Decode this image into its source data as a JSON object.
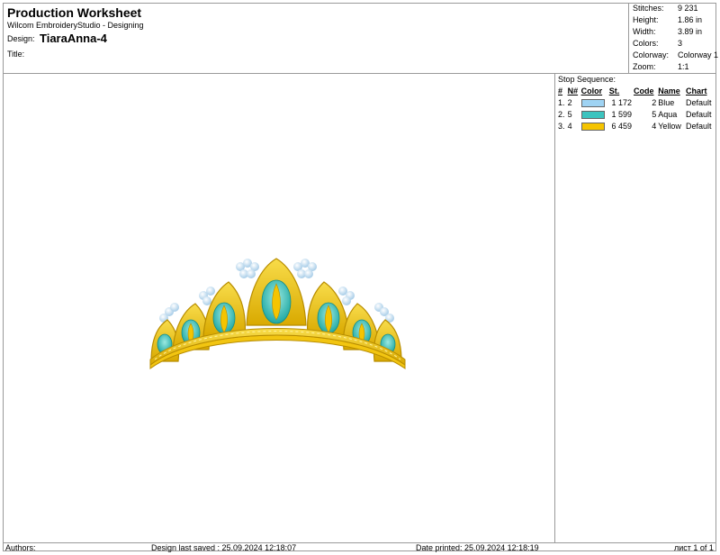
{
  "header": {
    "title": "Production Worksheet",
    "app": "Wilcom EmbroideryStudio - Designing",
    "design_label": "Design:",
    "design_value": "TiaraAnna-4",
    "title_label": "Title:"
  },
  "stats": [
    {
      "label": "Stitches:",
      "value": "9 231"
    },
    {
      "label": "Height:",
      "value": "1.86 in"
    },
    {
      "label": "Width:",
      "value": "3.89 in"
    },
    {
      "label": "Colors:",
      "value": "3"
    },
    {
      "label": "Colorway:",
      "value": "Colorway 1"
    },
    {
      "label": "Zoom:",
      "value": "1:1"
    }
  ],
  "stop_sequence": {
    "title": "Stop Sequence:",
    "headers": [
      "#",
      "N#",
      "Color",
      "St.",
      "Code",
      "Name",
      "Chart"
    ],
    "rows": [
      {
        "idx": "1.",
        "n": "2",
        "color": "#9fd3f3",
        "st": "1 172",
        "code": "2",
        "name": "Blue",
        "chart": "Default"
      },
      {
        "idx": "2.",
        "n": "5",
        "color": "#3cc4bf",
        "st": "1 599",
        "code": "5",
        "name": "Aqua",
        "chart": "Default"
      },
      {
        "idx": "3.",
        "n": "4",
        "color": "#f5c400",
        "st": "6 459",
        "code": "4",
        "name": "Yellow",
        "chart": "Default"
      }
    ]
  },
  "footer": {
    "authors": "Authors:",
    "last_saved": "Design last saved : 25.09.2024 12:18:07",
    "printed": "Date printed: 25.09.2024 12:18:19",
    "page": "лист 1 of 1"
  },
  "colors": {
    "gold": "#f2c511",
    "gold_dark": "#c99a00",
    "aqua": "#3cc4bf",
    "blue": "#b9dcf2"
  },
  "canvas": {
    "image": "embroidery-tiara-icon"
  }
}
